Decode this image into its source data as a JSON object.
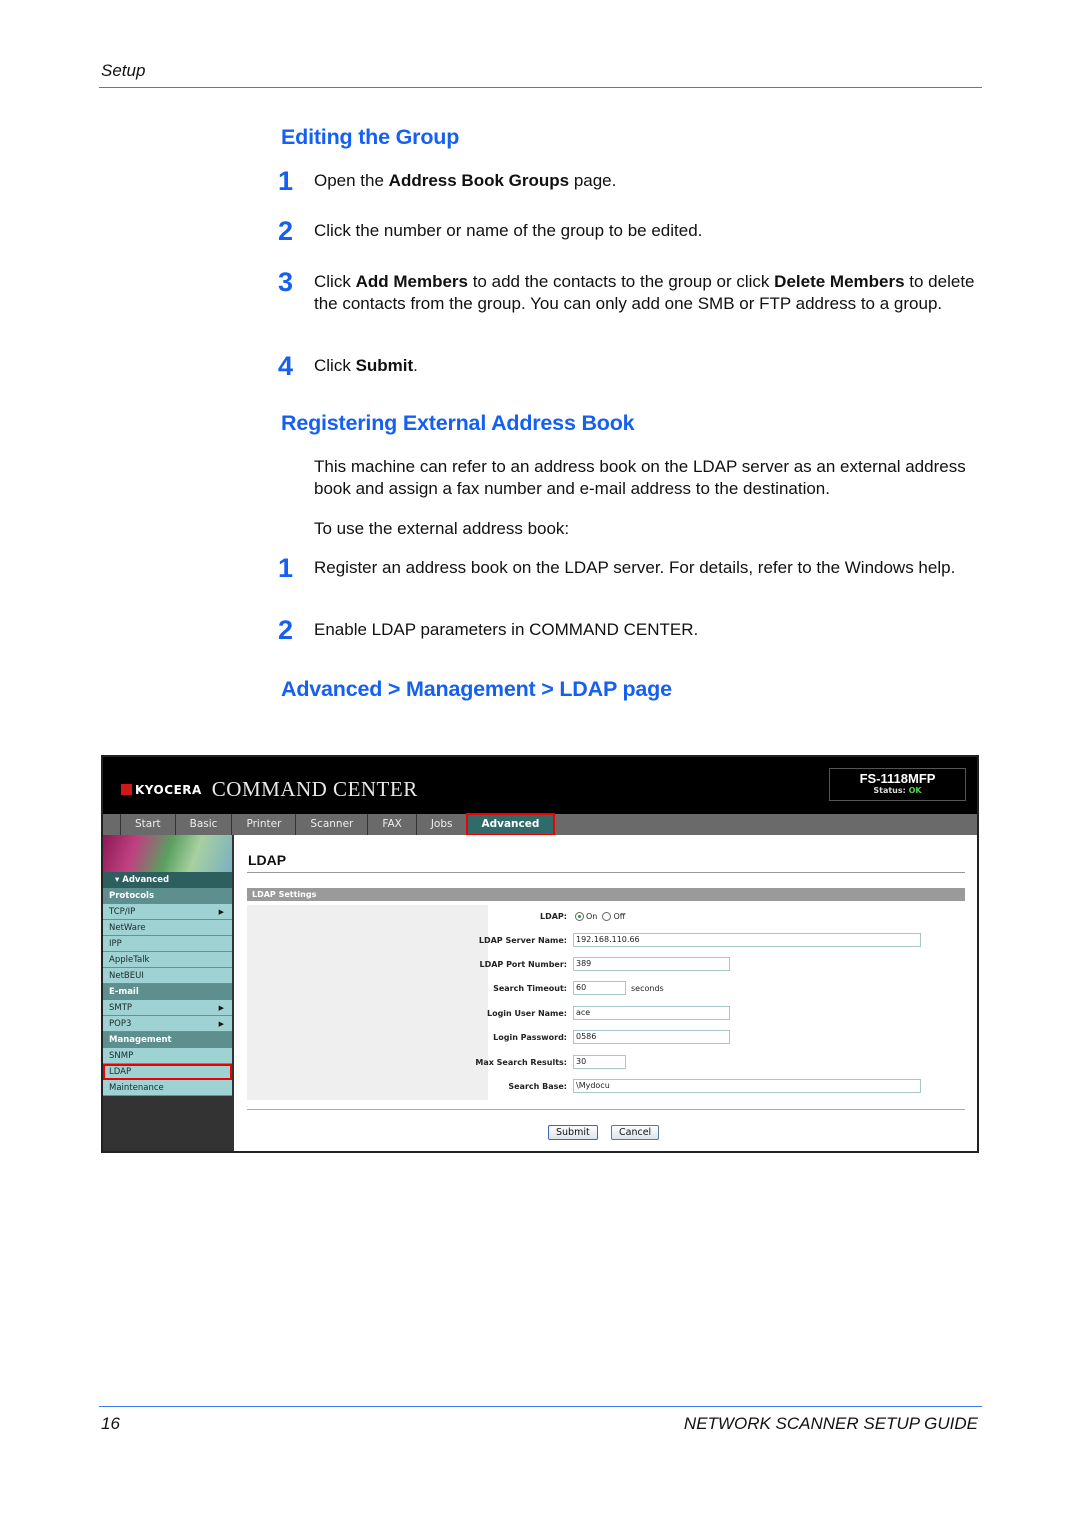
{
  "header": {
    "section": "Setup"
  },
  "editing_group": {
    "title": "Editing the Group",
    "steps": [
      {
        "num": "1",
        "pre": "Open the ",
        "bold": "Address Book Groups",
        "post": " page."
      },
      {
        "num": "2",
        "text": "Click the number or name of the group to be edited."
      },
      {
        "num": "3",
        "pre": "Click ",
        "bold1": "Add Members",
        "mid": " to add the contacts to the group or click ",
        "bold2": "Delete Members",
        "post": " to delete the contacts from the group.  You can only add one SMB or FTP address to a group."
      },
      {
        "num": "4",
        "pre": "Click ",
        "bold": "Submit",
        "post": "."
      }
    ]
  },
  "external_book": {
    "title": "Registering External Address Book",
    "intro": "This machine can refer to an address book on the LDAP server as an external address book and assign a fax number and e-mail address to the destination.",
    "lead": "To use the external address book:",
    "steps": [
      {
        "num": "1",
        "text": "Register an address book on the LDAP server. For details, refer to the Windows help."
      },
      {
        "num": "2",
        "text": "Enable LDAP parameters in COMMAND CENTER."
      }
    ]
  },
  "path_heading": "Advanced > Management > LDAP page",
  "command_center": {
    "brand": "KYOCERA",
    "title": "COMMAND CENTER",
    "model": "FS-1118MFP",
    "status_label": "Status:",
    "status_value": "OK",
    "tabs": [
      "Start",
      "Basic",
      "Printer",
      "Scanner",
      "FAX",
      "Jobs",
      "Advanced"
    ],
    "active_tab": "Advanced",
    "sidebar": {
      "root": "Advanced",
      "sections": [
        {
          "label": "Protocols",
          "items": [
            "TCP/IP",
            "NetWare",
            "IPP",
            "AppleTalk",
            "NetBEUI"
          ]
        },
        {
          "label": "E-mail",
          "items": [
            "SMTP",
            "POP3"
          ]
        },
        {
          "label": "Management",
          "items": [
            "SNMP",
            "LDAP",
            "Maintenance"
          ]
        }
      ],
      "highlighted": "LDAP"
    },
    "page_title": "LDAP",
    "settings_header": "LDAP Settings",
    "form": {
      "ldap_label": "LDAP:",
      "ldap_on": "On",
      "ldap_off": "Off",
      "ldap_selected": "On",
      "server_label": "LDAP Server Name:",
      "server_value": "192.168.110.66",
      "port_label": "LDAP Port Number:",
      "port_value": "389",
      "timeout_label": "Search Timeout:",
      "timeout_value": "60",
      "timeout_unit": "seconds",
      "user_label": "Login User Name:",
      "user_value": "ace",
      "password_label": "Login Password:",
      "password_value": "0586",
      "max_label": "Max Search Results:",
      "max_value": "30",
      "base_label": "Search Base:",
      "base_value": "\\Mydocu"
    },
    "submit_label": "Submit",
    "cancel_label": "Cancel"
  },
  "footer": {
    "page": "16",
    "title": "NETWORK SCANNER SETUP GUIDE"
  }
}
